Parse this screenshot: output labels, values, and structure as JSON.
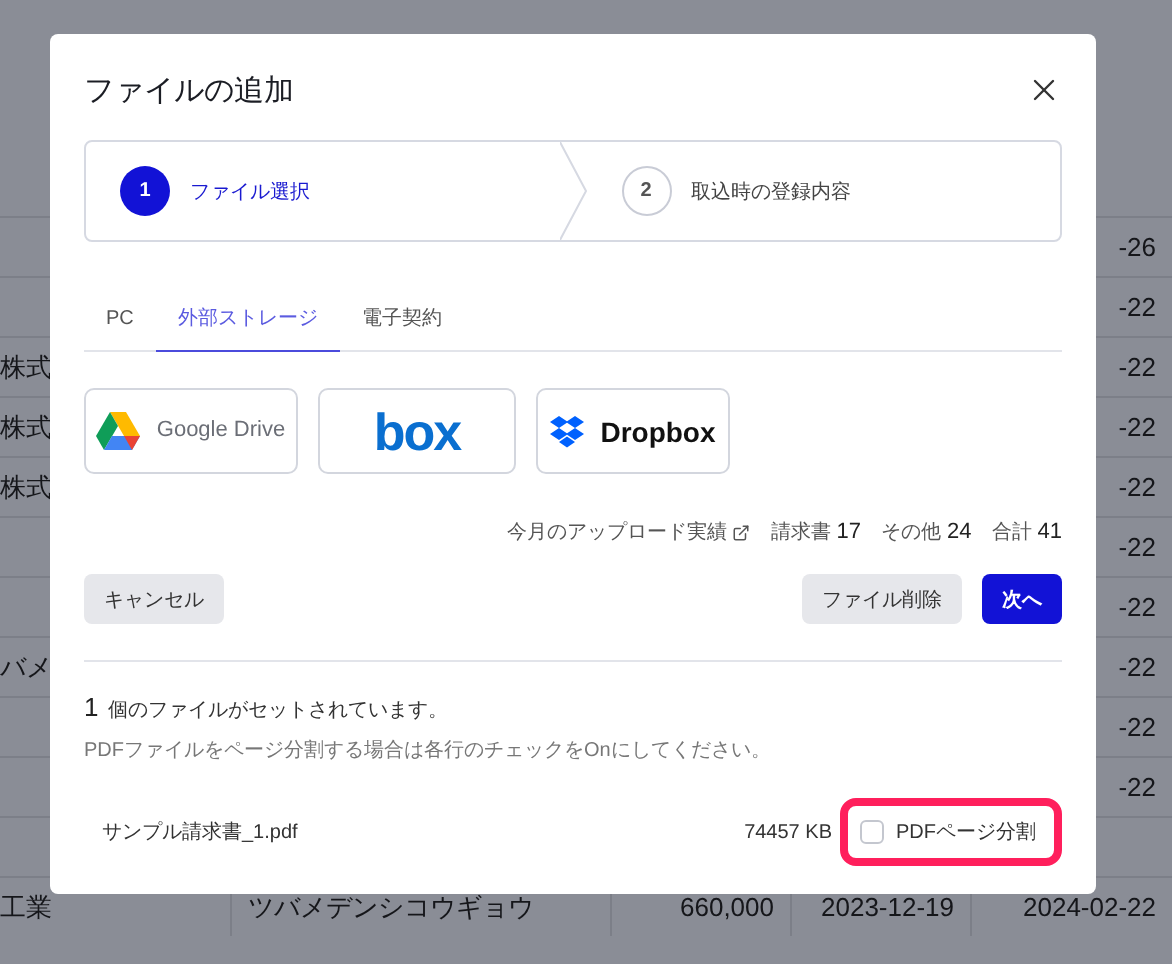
{
  "background_table": {
    "rows": [
      {
        "cells": [
          "",
          "",
          "",
          "",
          "-26"
        ]
      },
      {
        "cells": [
          "",
          "",
          "",
          "",
          "-22"
        ]
      },
      {
        "cells": [
          "株式",
          "",
          "",
          "",
          "-22"
        ]
      },
      {
        "cells": [
          "株式",
          "",
          "",
          "",
          "-22"
        ]
      },
      {
        "cells": [
          "株式",
          "",
          "",
          "",
          "-22"
        ]
      },
      {
        "cells": [
          "",
          "",
          "",
          "",
          "-22"
        ]
      },
      {
        "cells": [
          "",
          "",
          "",
          "",
          "-22"
        ]
      },
      {
        "cells": [
          "バメ",
          "",
          "",
          "",
          "-22"
        ]
      },
      {
        "cells": [
          "",
          "",
          "",
          "",
          "-22"
        ]
      },
      {
        "cells": [
          "",
          "",
          "",
          "",
          "-22"
        ]
      },
      {
        "cells": [
          "",
          "",
          "",
          "",
          ""
        ]
      },
      {
        "cells": [
          "工業",
          "ツバメデンシコウギョウ",
          "660,000",
          "2023-12-19",
          "2024-02-22"
        ]
      }
    ]
  },
  "dialog": {
    "title": "ファイルの追加",
    "steps": [
      {
        "number": "1",
        "label": "ファイル選択",
        "selected": true
      },
      {
        "number": "2",
        "label": "取込時の登録内容",
        "selected": false
      }
    ],
    "tabs": [
      {
        "label": "PC",
        "selected": false
      },
      {
        "label": "外部ストレージ",
        "selected": true
      },
      {
        "label": "電子契約",
        "selected": false
      }
    ],
    "storage_options": [
      {
        "kind": "google_drive",
        "label": "Google Drive"
      },
      {
        "kind": "box",
        "label": "box"
      },
      {
        "kind": "dropbox",
        "label": "Dropbox"
      }
    ],
    "upload_stats": {
      "label": "今月のアップロード実績",
      "items": [
        {
          "label": "請求書",
          "count": "17"
        },
        {
          "label": "その他",
          "count": "24"
        },
        {
          "label": "合計",
          "count": "41"
        }
      ]
    },
    "buttons": [
      {
        "label": "キャンセル",
        "kind": "secondary"
      },
      {
        "label": "ファイル削除",
        "kind": "secondary"
      },
      {
        "label": "次へ",
        "kind": "primary"
      }
    ],
    "file_summary": {
      "count": "1",
      "text": "個のファイルがセットされています。"
    },
    "hint": "PDFファイルをページ分割する場合は各行のチェックをOnにしてください。",
    "files": [
      {
        "name": "サンプル請求書_1.pdf",
        "size": "74457 KB",
        "split_label": "PDFページ分割",
        "checked": false,
        "highlighted": true
      }
    ]
  }
}
